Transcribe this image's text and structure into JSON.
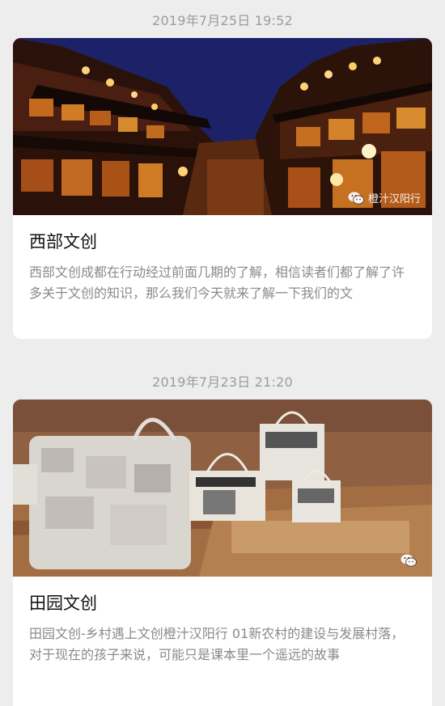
{
  "articles": [
    {
      "timestamp": "2019年7月25日 19:52",
      "title": "西部文创",
      "description": "西部文创成都在行动经过前面几期的了解，相信读者们都了解了许多关于文创的知识，那么我们今天就来了解一下我们的文",
      "watermark": "橙汁汉阳行",
      "image_icon": "wechat-icon"
    },
    {
      "timestamp": "2019年7月23日 21:20",
      "title": "田园文创",
      "description": "田园文创-乡村遇上文创橙汁汉阳行 01新农村的建设与发展村落，对于现在的孩子来说，可能只是课本里一个遥远的故事",
      "image_icon": "wechat-icon"
    }
  ],
  "colors": {
    "background": "#ededed",
    "card": "#ffffff",
    "timestamp": "#9c9c9c",
    "title": "#111111",
    "description": "#8a8a8a"
  }
}
